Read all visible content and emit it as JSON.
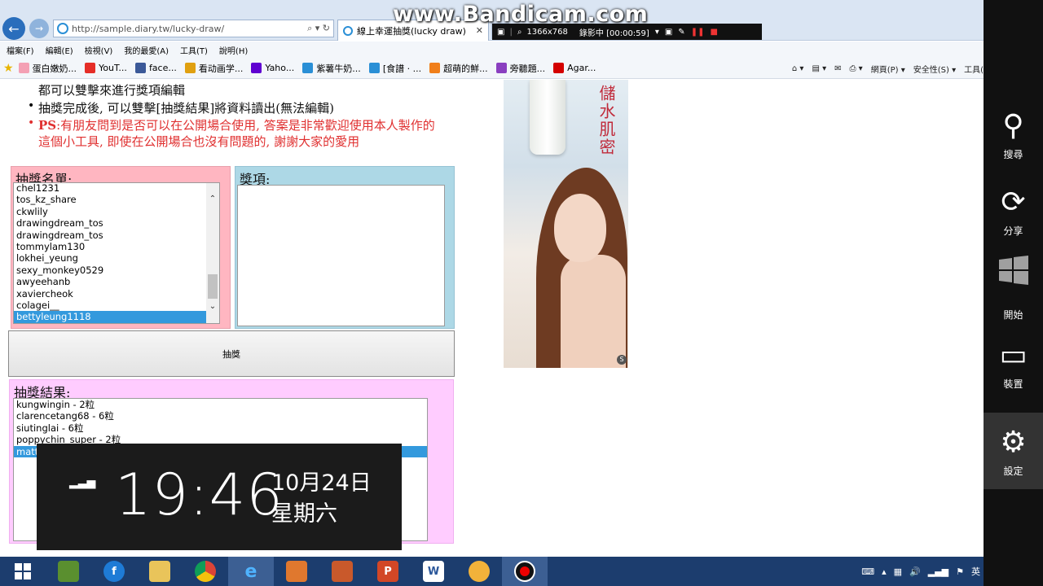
{
  "browser": {
    "url": "http://sample.diary.tw/lucky-draw/",
    "tab_title": "線上幸運抽獎(lucky draw)",
    "menu": [
      "檔案(F)",
      "編輯(E)",
      "檢視(V)",
      "我的最愛(A)",
      "工具(T)",
      "說明(H)"
    ],
    "favorites": [
      {
        "label": "蛋白嫩奶...",
        "color": "#f4a0b4"
      },
      {
        "label": "YouT...",
        "color": "#e52d27"
      },
      {
        "label": "face...",
        "color": "#3b5998"
      },
      {
        "label": "看动画学...",
        "color": "#e0a010"
      },
      {
        "label": "Yaho...",
        "color": "#5f01d1"
      },
      {
        "label": "紫薯牛奶...",
        "color": "#2a8fd6"
      },
      {
        "label": "[食譜 · ...",
        "color": "#2a8fd6"
      },
      {
        "label": "超萌的鮮...",
        "color": "#f07f1a"
      },
      {
        "label": "旁聽題...",
        "color": "#8a3fc0"
      },
      {
        "label": "Agar...",
        "color": "#d40000"
      }
    ],
    "commands": [
      "網頁(P) ▾",
      "安全性(S) ▾",
      "工具("
    ]
  },
  "recorder": {
    "watermark": "www.Bandicam.com",
    "resolution": "1366x768",
    "status": "錄影中 [00:00:59]"
  },
  "page": {
    "instructions": [
      {
        "text": "都可以雙擊來進行獎項編輯",
        "bullet": "",
        "color": "#111111"
      },
      {
        "text": "抽獎完成後, 可以雙擊[抽獎結果]將資料讀出(無法編輯)",
        "bullet": "•",
        "color": "#111111"
      },
      {
        "text": "PS:有朋友問到是否可以在公開場合使用, 答案是非常歡迎使用本人製作的",
        "bullet": "•",
        "color": "#e03030"
      },
      {
        "text": "這個小工具, 即使在公開場合也沒有問題的, 謝謝大家的愛用",
        "bullet": "",
        "color": "#e03030"
      }
    ],
    "entrants": {
      "title": "抽獎名單:",
      "items": [
        "chel1231",
        "tos_kz_share",
        "ckwlily",
        "drawingdream_tos",
        "drawingdream_tos",
        "tommylam130",
        "lokhei_yeung",
        "sexy_monkey0529",
        "awyeehanb",
        "xaviercheok",
        "colagei__",
        "bettyleung1118"
      ],
      "selected": "bettyleung1118"
    },
    "prizes": {
      "title": "獎項:",
      "items": []
    },
    "draw_button": "抽獎",
    "results": {
      "title": "抽獎結果:",
      "items": [
        "kungwingin - 2粒",
        "clarencetang68 - 6粒",
        "siutinglai - 6粒",
        "poppychin_super - 2粒",
        "matt"
      ]
    },
    "ad": {
      "slogan": "儲水肌密",
      "badge": "S"
    }
  },
  "charms": [
    {
      "icon": "search-icon",
      "label": "搜尋"
    },
    {
      "icon": "share-icon",
      "label": "分享"
    },
    {
      "icon": "windows-start-icon",
      "label": "開始"
    },
    {
      "icon": "devices-icon",
      "label": "裝置"
    },
    {
      "icon": "gear-icon",
      "label": "設定"
    }
  ],
  "clock": {
    "time": "19:46",
    "date": "10月24日",
    "weekday": "星期六"
  },
  "taskbar": {
    "tray_lang": "英"
  }
}
